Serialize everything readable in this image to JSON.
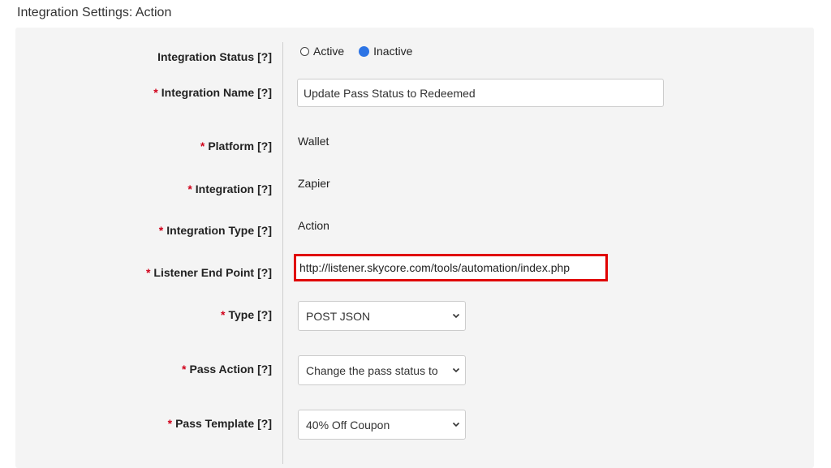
{
  "page": {
    "title": "Integration Settings: Action"
  },
  "help_marker": "[?]",
  "fields": {
    "status": {
      "label": "Integration Status",
      "options": [
        "Active",
        "Inactive"
      ],
      "selected": "Inactive"
    },
    "name": {
      "label": "Integration Name",
      "required_mark": "*",
      "value": "Update Pass Status to Redeemed"
    },
    "platform": {
      "label": "Platform",
      "required_mark": "*",
      "value": "Wallet"
    },
    "integration": {
      "label": "Integration",
      "required_mark": "*",
      "value": "Zapier"
    },
    "integration_type": {
      "label": "Integration Type",
      "required_mark": "*",
      "value": "Action"
    },
    "listener_endpoint": {
      "label": "Listener End Point",
      "required_mark": "*",
      "value": "http://listener.skycore.com/tools/automation/index.php",
      "highlight_color": "#e00000"
    },
    "type": {
      "label": "Type",
      "required_mark": "*",
      "selected": "POST JSON"
    },
    "pass_action": {
      "label": "Pass Action",
      "required_mark": "*",
      "selected": "Change the pass status to"
    },
    "pass_template": {
      "label": "Pass Template",
      "required_mark": "*",
      "selected": "40% Off Coupon"
    }
  },
  "colors": {
    "required": "#d0021b",
    "radio_selected": "#2d74e5",
    "panel_bg": "#f4f4f4"
  },
  "icons": {
    "select_arrow": "chevron-down-icon"
  }
}
